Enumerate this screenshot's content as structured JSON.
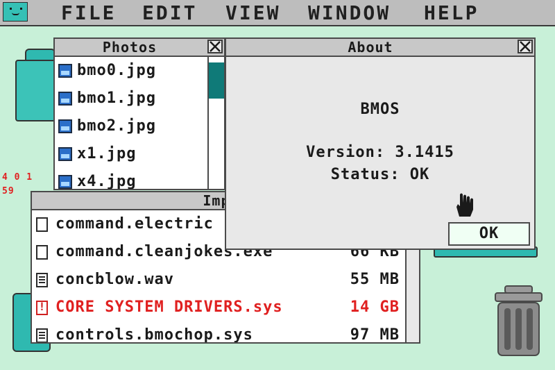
{
  "menubar": {
    "items": [
      "FILE",
      "EDIT",
      "VIEW",
      "WINDOW",
      "HELP"
    ]
  },
  "desktop": {
    "counter_line1": "4 0 1",
    "counter_line2": "59"
  },
  "photos_window": {
    "title": "Photos",
    "files": [
      "bmo0.jpg",
      "bmo1.jpg",
      "bmo2.jpg",
      "x1.jpg",
      "x4.jpg"
    ]
  },
  "import_window": {
    "title": "Impor",
    "files": [
      {
        "name": "command.electric",
        "size": "",
        "icon": "blank-file-icon",
        "status": "normal"
      },
      {
        "name": "command.cleanjokes.exe",
        "size": "66 KB",
        "icon": "blank-file-icon",
        "status": "normal"
      },
      {
        "name": "concblow.wav",
        "size": "55 MB",
        "icon": "document-icon",
        "status": "normal"
      },
      {
        "name": "CORE SYSTEM DRIVERS.sys",
        "size": "14 GB",
        "icon": "warning-icon",
        "status": "danger"
      },
      {
        "name": "controls.bmochop.sys",
        "size": "97 MB",
        "icon": "document-icon",
        "status": "normal"
      }
    ]
  },
  "about_window": {
    "title": "About",
    "app_name": "BMOS",
    "version": "Version: 3.1415",
    "status": "Status: OK",
    "ok_label": "OK"
  },
  "colors": {
    "desktop_bg": "#c8f0d8",
    "accent_teal": "#2fb9b0",
    "danger_red": "#e02020"
  }
}
